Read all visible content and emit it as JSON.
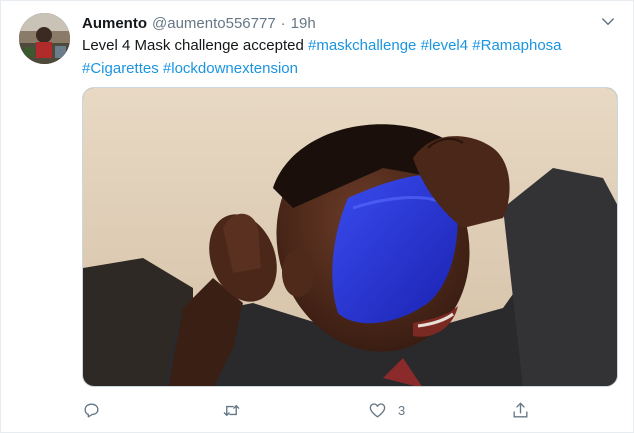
{
  "tweet": {
    "author_name": "Aumento",
    "author_handle": "@aumento556777",
    "separator": "·",
    "timestamp": "19h",
    "text_plain": "Level 4 Mask challenge accepted",
    "hashtags": [
      "#maskchallenge",
      "#level4",
      "#Ramaphosa",
      "#Cigarettes",
      "#lockdownextension"
    ],
    "media_alt": "Man covering his eyes with a blue face mask"
  },
  "actions": {
    "reply_count": "",
    "retweet_count": "",
    "like_count": "3",
    "share_count": ""
  },
  "colors": {
    "hashtag": "#1b95e0",
    "secondary_text": "#657786",
    "primary_text": "#14171a",
    "mask_blue": "#2433d6"
  },
  "icons": {
    "reply": "reply-icon",
    "retweet": "retweet-icon",
    "like": "heart-icon",
    "share": "share-icon",
    "menu": "chevron-down-icon"
  }
}
